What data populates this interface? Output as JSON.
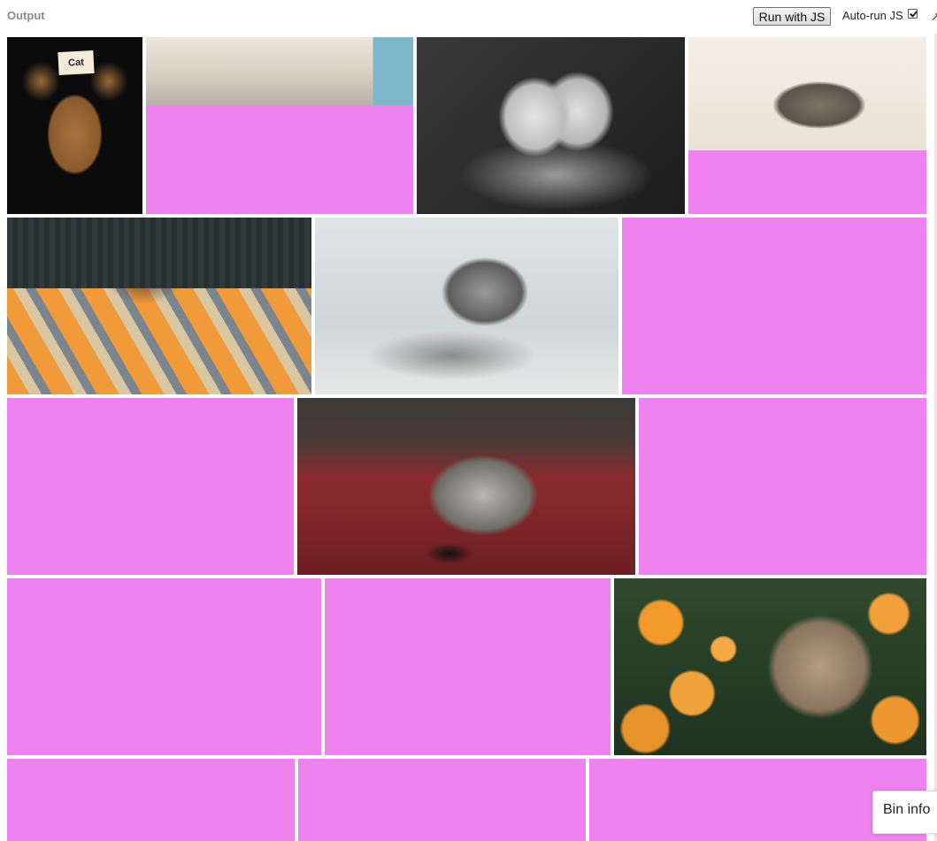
{
  "topbar": {
    "title": "Output",
    "run_button_label": "Run with JS",
    "autorun_label": "Auto-run JS",
    "autorun_checked": true,
    "expand_icon": "expand-arrow-icon"
  },
  "tile_color": "#ee82ee",
  "tiles": [
    {
      "kind": "photo",
      "subject": "dog wearing a Cat note",
      "label": "Cat"
    },
    {
      "kind": "photo-partial",
      "subject": "cat on stairs"
    },
    {
      "kind": "photo",
      "subject": "baby feet in hands"
    },
    {
      "kind": "photo-partial",
      "subject": "tabby kitten on bed"
    },
    {
      "kind": "photo",
      "subject": "cat on striped cushion"
    },
    {
      "kind": "photo",
      "subject": "silver tabby kitten by window"
    },
    {
      "kind": "placeholder"
    },
    {
      "kind": "placeholder"
    },
    {
      "kind": "photo",
      "subject": "cat lying on red carpet"
    },
    {
      "kind": "placeholder"
    },
    {
      "kind": "placeholder"
    },
    {
      "kind": "placeholder"
    },
    {
      "kind": "photo",
      "subject": "tabby cat among orange flowers"
    },
    {
      "kind": "placeholder"
    },
    {
      "kind": "placeholder"
    },
    {
      "kind": "placeholder"
    }
  ],
  "bin_info": {
    "label": "Bin info"
  }
}
